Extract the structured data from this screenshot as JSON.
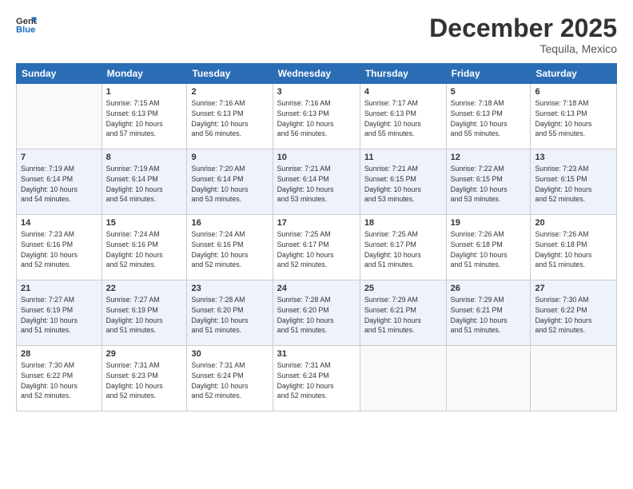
{
  "header": {
    "logo_line1": "General",
    "logo_line2": "Blue",
    "month": "December 2025",
    "location": "Tequila, Mexico"
  },
  "days_of_week": [
    "Sunday",
    "Monday",
    "Tuesday",
    "Wednesday",
    "Thursday",
    "Friday",
    "Saturday"
  ],
  "weeks": [
    [
      {
        "day": "",
        "text": ""
      },
      {
        "day": "1",
        "text": "Sunrise: 7:15 AM\nSunset: 6:13 PM\nDaylight: 10 hours\nand 57 minutes."
      },
      {
        "day": "2",
        "text": "Sunrise: 7:16 AM\nSunset: 6:13 PM\nDaylight: 10 hours\nand 56 minutes."
      },
      {
        "day": "3",
        "text": "Sunrise: 7:16 AM\nSunset: 6:13 PM\nDaylight: 10 hours\nand 56 minutes."
      },
      {
        "day": "4",
        "text": "Sunrise: 7:17 AM\nSunset: 6:13 PM\nDaylight: 10 hours\nand 55 minutes."
      },
      {
        "day": "5",
        "text": "Sunrise: 7:18 AM\nSunset: 6:13 PM\nDaylight: 10 hours\nand 55 minutes."
      },
      {
        "day": "6",
        "text": "Sunrise: 7:18 AM\nSunset: 6:13 PM\nDaylight: 10 hours\nand 55 minutes."
      }
    ],
    [
      {
        "day": "7",
        "text": "Sunrise: 7:19 AM\nSunset: 6:14 PM\nDaylight: 10 hours\nand 54 minutes."
      },
      {
        "day": "8",
        "text": "Sunrise: 7:19 AM\nSunset: 6:14 PM\nDaylight: 10 hours\nand 54 minutes."
      },
      {
        "day": "9",
        "text": "Sunrise: 7:20 AM\nSunset: 6:14 PM\nDaylight: 10 hours\nand 53 minutes."
      },
      {
        "day": "10",
        "text": "Sunrise: 7:21 AM\nSunset: 6:14 PM\nDaylight: 10 hours\nand 53 minutes."
      },
      {
        "day": "11",
        "text": "Sunrise: 7:21 AM\nSunset: 6:15 PM\nDaylight: 10 hours\nand 53 minutes."
      },
      {
        "day": "12",
        "text": "Sunrise: 7:22 AM\nSunset: 6:15 PM\nDaylight: 10 hours\nand 53 minutes."
      },
      {
        "day": "13",
        "text": "Sunrise: 7:23 AM\nSunset: 6:15 PM\nDaylight: 10 hours\nand 52 minutes."
      }
    ],
    [
      {
        "day": "14",
        "text": "Sunrise: 7:23 AM\nSunset: 6:16 PM\nDaylight: 10 hours\nand 52 minutes."
      },
      {
        "day": "15",
        "text": "Sunrise: 7:24 AM\nSunset: 6:16 PM\nDaylight: 10 hours\nand 52 minutes."
      },
      {
        "day": "16",
        "text": "Sunrise: 7:24 AM\nSunset: 6:16 PM\nDaylight: 10 hours\nand 52 minutes."
      },
      {
        "day": "17",
        "text": "Sunrise: 7:25 AM\nSunset: 6:17 PM\nDaylight: 10 hours\nand 52 minutes."
      },
      {
        "day": "18",
        "text": "Sunrise: 7:25 AM\nSunset: 6:17 PM\nDaylight: 10 hours\nand 51 minutes."
      },
      {
        "day": "19",
        "text": "Sunrise: 7:26 AM\nSunset: 6:18 PM\nDaylight: 10 hours\nand 51 minutes."
      },
      {
        "day": "20",
        "text": "Sunrise: 7:26 AM\nSunset: 6:18 PM\nDaylight: 10 hours\nand 51 minutes."
      }
    ],
    [
      {
        "day": "21",
        "text": "Sunrise: 7:27 AM\nSunset: 6:19 PM\nDaylight: 10 hours\nand 51 minutes."
      },
      {
        "day": "22",
        "text": "Sunrise: 7:27 AM\nSunset: 6:19 PM\nDaylight: 10 hours\nand 51 minutes."
      },
      {
        "day": "23",
        "text": "Sunrise: 7:28 AM\nSunset: 6:20 PM\nDaylight: 10 hours\nand 51 minutes."
      },
      {
        "day": "24",
        "text": "Sunrise: 7:28 AM\nSunset: 6:20 PM\nDaylight: 10 hours\nand 51 minutes."
      },
      {
        "day": "25",
        "text": "Sunrise: 7:29 AM\nSunset: 6:21 PM\nDaylight: 10 hours\nand 51 minutes."
      },
      {
        "day": "26",
        "text": "Sunrise: 7:29 AM\nSunset: 6:21 PM\nDaylight: 10 hours\nand 51 minutes."
      },
      {
        "day": "27",
        "text": "Sunrise: 7:30 AM\nSunset: 6:22 PM\nDaylight: 10 hours\nand 52 minutes."
      }
    ],
    [
      {
        "day": "28",
        "text": "Sunrise: 7:30 AM\nSunset: 6:22 PM\nDaylight: 10 hours\nand 52 minutes."
      },
      {
        "day": "29",
        "text": "Sunrise: 7:31 AM\nSunset: 6:23 PM\nDaylight: 10 hours\nand 52 minutes."
      },
      {
        "day": "30",
        "text": "Sunrise: 7:31 AM\nSunset: 6:24 PM\nDaylight: 10 hours\nand 52 minutes."
      },
      {
        "day": "31",
        "text": "Sunrise: 7:31 AM\nSunset: 6:24 PM\nDaylight: 10 hours\nand 52 minutes."
      },
      {
        "day": "",
        "text": ""
      },
      {
        "day": "",
        "text": ""
      },
      {
        "day": "",
        "text": ""
      }
    ]
  ]
}
